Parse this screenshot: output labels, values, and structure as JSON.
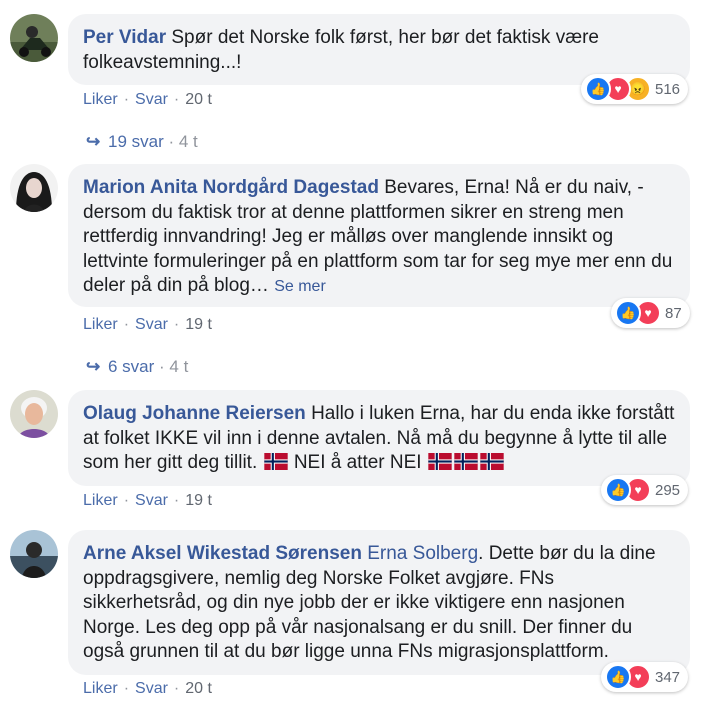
{
  "comments": [
    {
      "author": "Per Vidar",
      "text": "Spør det Norske folk først, her bør det faktisk være folkeavstemning...!",
      "actions": {
        "like": "Liker",
        "reply": "Svar",
        "time": "20 t"
      },
      "reactions": {
        "icons": [
          "like-icon",
          "love-icon",
          "angry-icon"
        ],
        "count": "516"
      },
      "replies": {
        "label": "19 svar",
        "ago": "4 t"
      }
    },
    {
      "author": "Marion Anita Nordgård Dagestad",
      "text": "Bevares, Erna! Nå er du naiv, - dersom du faktisk tror at denne plattformen sikrer en streng men rettferdig innvandring! Jeg er målløs over manglende innsikt og lettvinte formuleringer på en plattform som tar for seg mye mer enn du deler på din på blog…",
      "see_more": "Se mer",
      "actions": {
        "like": "Liker",
        "reply": "Svar",
        "time": "19 t"
      },
      "reactions": {
        "icons": [
          "like-icon",
          "love-icon"
        ],
        "count": "87"
      },
      "replies": {
        "label": "6 svar",
        "ago": "4 t"
      }
    },
    {
      "author": "Olaug Johanne Reiersen",
      "text_before": "Hallo i luken Erna, har du enda ikke forstått at folket IKKE vil inn i denne avtalen. Nå må du begynne å lytte til alle som her gitt deg tillit.",
      "text_after": "NEI å atter NEI",
      "actions": {
        "like": "Liker",
        "reply": "Svar",
        "time": "19 t"
      },
      "reactions": {
        "icons": [
          "like-icon",
          "love-icon"
        ],
        "count": "295"
      }
    },
    {
      "author": "Arne Aksel Wikestad Sørensen",
      "mention": "Erna Solberg",
      "text": ". Dette bør du la dine oppdragsgivere, nemlig deg Norske Folket avgjøre. FNs sikkerhetsråd, og din nye jobb der er ikke viktigere enn nasjonen Norge. Les deg opp på vår nasjonalsang er du snill. Der finner du også grunnen til at du bør ligge unna FNs migrasjonsplattform.",
      "actions": {
        "like": "Liker",
        "reply": "Svar",
        "time": "20 t"
      },
      "reactions": {
        "icons": [
          "like-icon",
          "love-icon"
        ],
        "count": "347"
      }
    }
  ],
  "colors": {
    "link": "#385898",
    "bubble": "#f2f3f5",
    "like": "#1877f2",
    "love": "#f33e58",
    "angry": "#f7b125"
  }
}
